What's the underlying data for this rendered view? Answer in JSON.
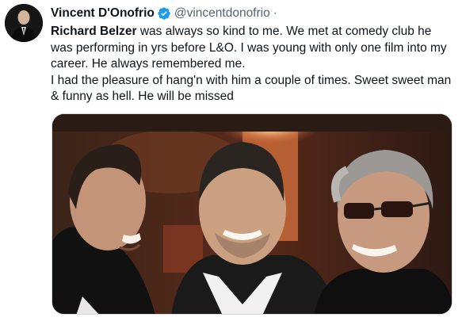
{
  "author": {
    "display_name": "Vincent D'Onofrio",
    "handle": "@vincentdonofrio",
    "separator": "·",
    "verified": true,
    "verified_color": "#1d9bf0"
  },
  "tweet": {
    "mention": "Richard Belzer",
    "line1_rest": " was always so kind to me. We met at comedy club he was performing in yrs before L&O. I was young with only one film into my career. He always remembered me.",
    "line2": "I had the pleasure of hang'n with him a couple of times. Sweet sweet man & funny as hell. He will be missed"
  },
  "icons": {
    "verified": "verified-badge-icon"
  },
  "media": {
    "kind": "photo",
    "subject": "three smiling men at an event"
  }
}
